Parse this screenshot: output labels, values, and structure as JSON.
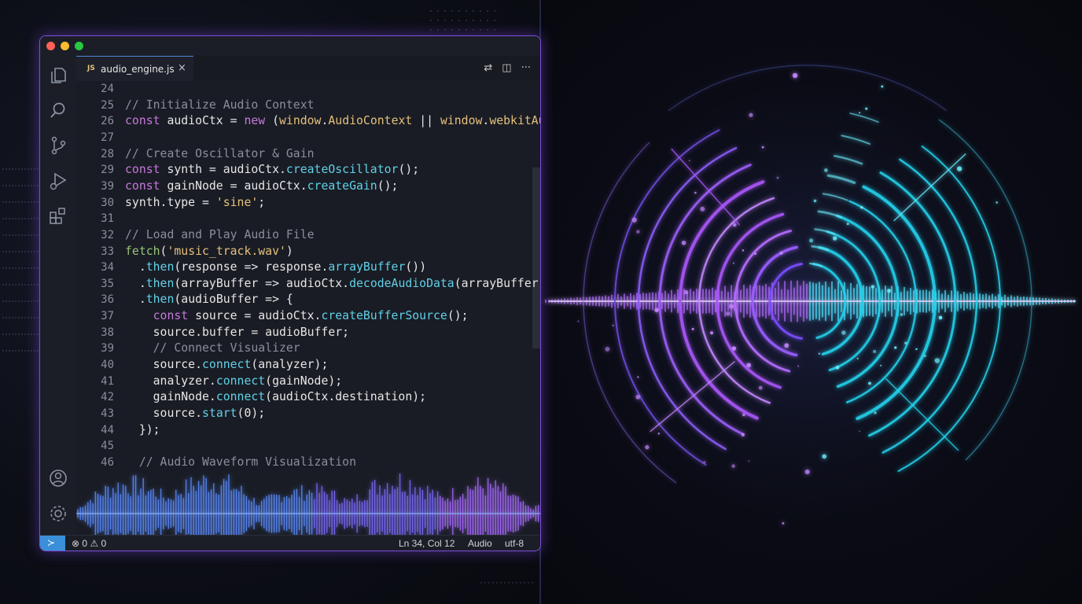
{
  "editor": {
    "tab": {
      "lang_badge": "JS",
      "filename": "audio_engine.js",
      "close": "×"
    },
    "tab_actions": [
      "⇄",
      "◫",
      "···"
    ],
    "lines": [
      {
        "n": "24",
        "tokens": []
      },
      {
        "n": "25",
        "tokens": [
          {
            "t": "// Initialize Audio Context",
            "c": "cm"
          }
        ]
      },
      {
        "n": "26",
        "tokens": [
          {
            "t": "const ",
            "c": "kw"
          },
          {
            "t": "audioCtx = "
          },
          {
            "t": "new ",
            "c": "kw"
          },
          {
            "t": "("
          },
          {
            "t": "window",
            "c": "glob"
          },
          {
            "t": "."
          },
          {
            "t": "AudioContext",
            "c": "glob"
          },
          {
            "t": " || "
          },
          {
            "t": "window",
            "c": "glob"
          },
          {
            "t": "."
          },
          {
            "t": "webkitAudioContext",
            "c": "glob"
          },
          {
            "t": ")();"
          }
        ]
      },
      {
        "n": "27",
        "tokens": []
      },
      {
        "n": "28",
        "tokens": [
          {
            "t": "// Create Oscillator & Gain",
            "c": "cm"
          }
        ]
      },
      {
        "n": "29",
        "tokens": [
          {
            "t": "const ",
            "c": "kw"
          },
          {
            "t": "synth = audioCtx."
          },
          {
            "t": "createOscillator",
            "c": "fn"
          },
          {
            "t": "();"
          }
        ]
      },
      {
        "n": "39",
        "tokens": [
          {
            "t": "const ",
            "c": "kw"
          },
          {
            "t": "gainNode = audioCtx."
          },
          {
            "t": "createGain",
            "c": "fn"
          },
          {
            "t": "();"
          }
        ]
      },
      {
        "n": "30",
        "tokens": [
          {
            "t": "synth.type = "
          },
          {
            "t": "'sine'",
            "c": "st"
          },
          {
            "t": ";"
          }
        ]
      },
      {
        "n": "31",
        "tokens": []
      },
      {
        "n": "32",
        "tokens": [
          {
            "t": "// Load and Play Audio File",
            "c": "cm"
          }
        ]
      },
      {
        "n": "33",
        "tokens": [
          {
            "t": "fetch",
            "c": "sb"
          },
          {
            "t": "("
          },
          {
            "t": "'music_track.wav'",
            "c": "st"
          },
          {
            "t": ")"
          }
        ]
      },
      {
        "n": "34",
        "tokens": [
          {
            "t": "  ."
          },
          {
            "t": "then",
            "c": "fn"
          },
          {
            "t": "(response => response."
          },
          {
            "t": "arrayBuffer",
            "c": "fn"
          },
          {
            "t": "())"
          }
        ]
      },
      {
        "n": "35",
        "tokens": [
          {
            "t": "  ."
          },
          {
            "t": "then",
            "c": "fn"
          },
          {
            "t": "(arrayBuffer => audioCtx."
          },
          {
            "t": "decodeAudioData",
            "c": "fn"
          },
          {
            "t": "(arrayBuffer))"
          }
        ]
      },
      {
        "n": "36",
        "tokens": [
          {
            "t": "  ."
          },
          {
            "t": "then",
            "c": "fn"
          },
          {
            "t": "(audioBuffer => {"
          }
        ]
      },
      {
        "n": "37",
        "tokens": [
          {
            "t": "    const ",
            "c": "kw"
          },
          {
            "t": "source = audioCtx."
          },
          {
            "t": "createBufferSource",
            "c": "fn"
          },
          {
            "t": "();"
          }
        ]
      },
      {
        "n": "38",
        "tokens": [
          {
            "t": "    source.buffer = audioBuffer;"
          }
        ]
      },
      {
        "n": "39",
        "tokens": [
          {
            "t": "    // Connect Visualizer",
            "c": "cm"
          }
        ]
      },
      {
        "n": "40",
        "tokens": [
          {
            "t": "    source."
          },
          {
            "t": "connect",
            "c": "fn"
          },
          {
            "t": "(analyzer);"
          }
        ]
      },
      {
        "n": "41",
        "tokens": [
          {
            "t": "    analyzer."
          },
          {
            "t": "connect",
            "c": "fn"
          },
          {
            "t": "(gainNode);"
          }
        ]
      },
      {
        "n": "42",
        "tokens": [
          {
            "t": "    gainNode."
          },
          {
            "t": "connect",
            "c": "fn"
          },
          {
            "t": "(audioCtx.destination);"
          }
        ]
      },
      {
        "n": "43",
        "tokens": [
          {
            "t": "    source."
          },
          {
            "t": "start",
            "c": "fn"
          },
          {
            "t": "(0);"
          }
        ]
      },
      {
        "n": "44",
        "tokens": [
          {
            "t": "  });"
          }
        ]
      },
      {
        "n": "45",
        "tokens": []
      },
      {
        "n": "46",
        "tokens": [
          {
            "t": "  // Audio Waveform Visualization",
            "c": "cm"
          }
        ]
      }
    ]
  },
  "statusbar": {
    "remote_icon": "remote-icon",
    "problems": "⊗ 0 ⚠ 0",
    "cursor": "Ln 34, Col 12",
    "language": "Audio",
    "encoding": "utf-8"
  },
  "activity_icons": [
    "explorer-icon",
    "search-icon",
    "source-control-icon",
    "run-debug-icon",
    "extensions-icon",
    "account-icon",
    "settings-icon"
  ],
  "colors": {
    "accent_border": "#7b4fd6",
    "status_remote": "#3a8fd8",
    "viz_purple": "#a855f7",
    "viz_cyan": "#22d3ee"
  }
}
